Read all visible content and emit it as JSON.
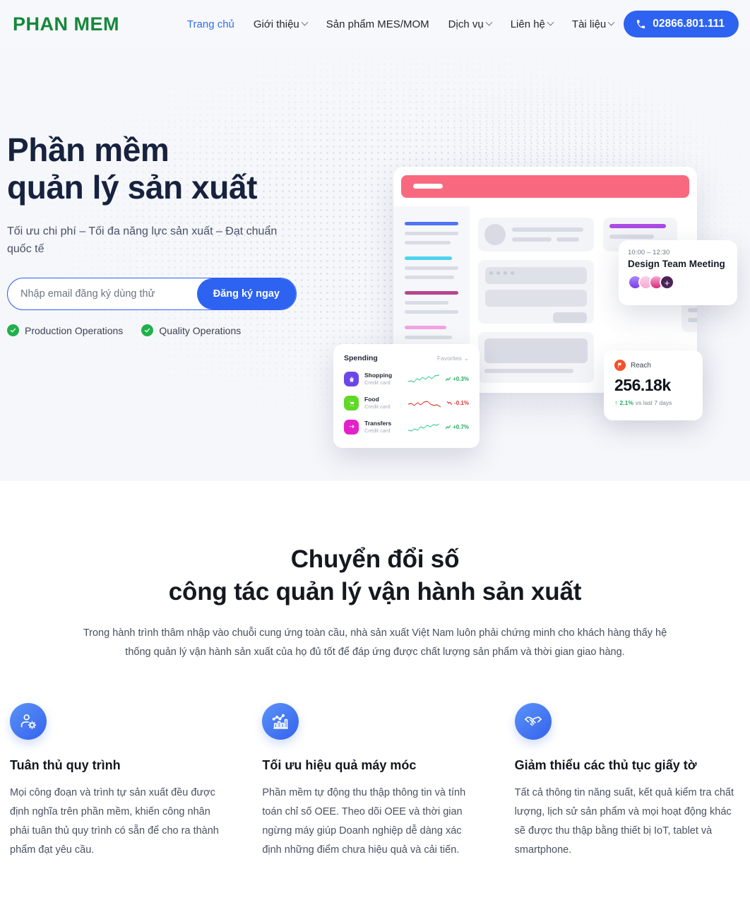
{
  "header": {
    "logo": "PHAN MEM",
    "nav": [
      {
        "label": "Trang chủ",
        "active": true,
        "caret": false
      },
      {
        "label": "Giới thiệu",
        "active": false,
        "caret": true
      },
      {
        "label": "Sản phẩm MES/MOM",
        "active": false,
        "caret": false
      },
      {
        "label": "Dịch vụ",
        "active": false,
        "caret": true
      },
      {
        "label": "Liên hệ",
        "active": false,
        "caret": true
      },
      {
        "label": "Tài liệu",
        "active": false,
        "caret": true
      }
    ],
    "phone": "02866.801.111",
    "accent_color": "#2d63f0",
    "logo_color": "#15883c"
  },
  "hero": {
    "title_line1": "Phần mềm",
    "title_line2": "quản lý sản xuất",
    "subtitle": "Tối ưu chi phí – Tối đa năng lực sản xuất – Đạt chuẩn quốc tế",
    "email_placeholder": "Nhập email đăng ký dùng thử",
    "email_value": "",
    "cta_label": "Đăng ký ngay",
    "badges": [
      {
        "label": "Production Operations"
      },
      {
        "label": "Quality Operations"
      }
    ]
  },
  "illustration": {
    "meeting_card": {
      "time": "10:00 – 12:30",
      "title": "Design Team Meeting",
      "add_label": "+",
      "avatar_colors": [
        "#8b5cf6",
        "#f9a8d4",
        "#f472b6"
      ],
      "plus_color": "#4a2456"
    },
    "reach_card": {
      "label": "Reach",
      "value": "256.18k",
      "delta": "2.1%",
      "delta_suffix": "vs last 7 days",
      "arrow": "↑",
      "icon_color": "#f4512c",
      "delta_color": "#1dae5f"
    },
    "spending_card": {
      "title": "Spending",
      "filter": "Favorites",
      "rows": [
        {
          "name": "Shopping",
          "sub": "Credit card",
          "change": "+0.3%",
          "trend": "up",
          "color": "#6c47e8",
          "change_color": "#1dae5f"
        },
        {
          "name": "Food",
          "sub": "Credit card",
          "change": "-0.1%",
          "trend": "down",
          "color": "#5fd926",
          "change_color": "#e0342f"
        },
        {
          "name": "Transfers",
          "sub": "Credit card",
          "change": "+0.7%",
          "trend": "up",
          "color": "#e321c8",
          "change_color": "#1dae5f"
        }
      ]
    },
    "sidebar_accents": [
      "#4f74f5",
      "#4cd3ef",
      "#b6468f",
      "#f0a3e0"
    ],
    "topbar_color": "#f8697f"
  },
  "section2": {
    "heading_line1": "Chuyển đổi số",
    "heading_line2": "công tác quản lý vận hành sản xuất",
    "paragraph": "Trong hành trình thâm nhập vào chuỗi cung ứng toàn cầu, nhà sản xuất Việt Nam luôn phải chứng minh cho khách hàng thấy hệ thống quản lý vận hành sản xuất của họ đủ tốt để đáp ứng được chất lượng sản phẩm và thời gian giao hàng.",
    "features": [
      {
        "icon": "user-gear-icon",
        "title": "Tuân thủ quy trình",
        "desc": "Mọi công đoạn và trình tự sản xuất đều được định nghĩa trên phần mềm, khiến công nhân phải tuân thủ quy trình có sẵn để cho ra thành phẩm đạt yêu cầu."
      },
      {
        "icon": "bar-chart-icon",
        "title": "Tối ưu hiệu quả máy móc",
        "desc": "Phần mềm tự động thu thập thông tin và tính toán chỉ số OEE. Theo dõi OEE và thời gian ngừng máy giúp Doanh nghiệp dễ dàng xác định những điểm chưa hiệu quả và cải tiến."
      },
      {
        "icon": "handshake-icon",
        "title": "Giảm thiểu các thủ tục giấy tờ",
        "desc": "Tất cả thông tin năng suất, kết quả kiểm tra chất lượng, lịch sử sản phẩm và mọi hoạt động khác sẽ được thu thập bằng thiết bị IoT, tablet và smartphone."
      }
    ]
  }
}
